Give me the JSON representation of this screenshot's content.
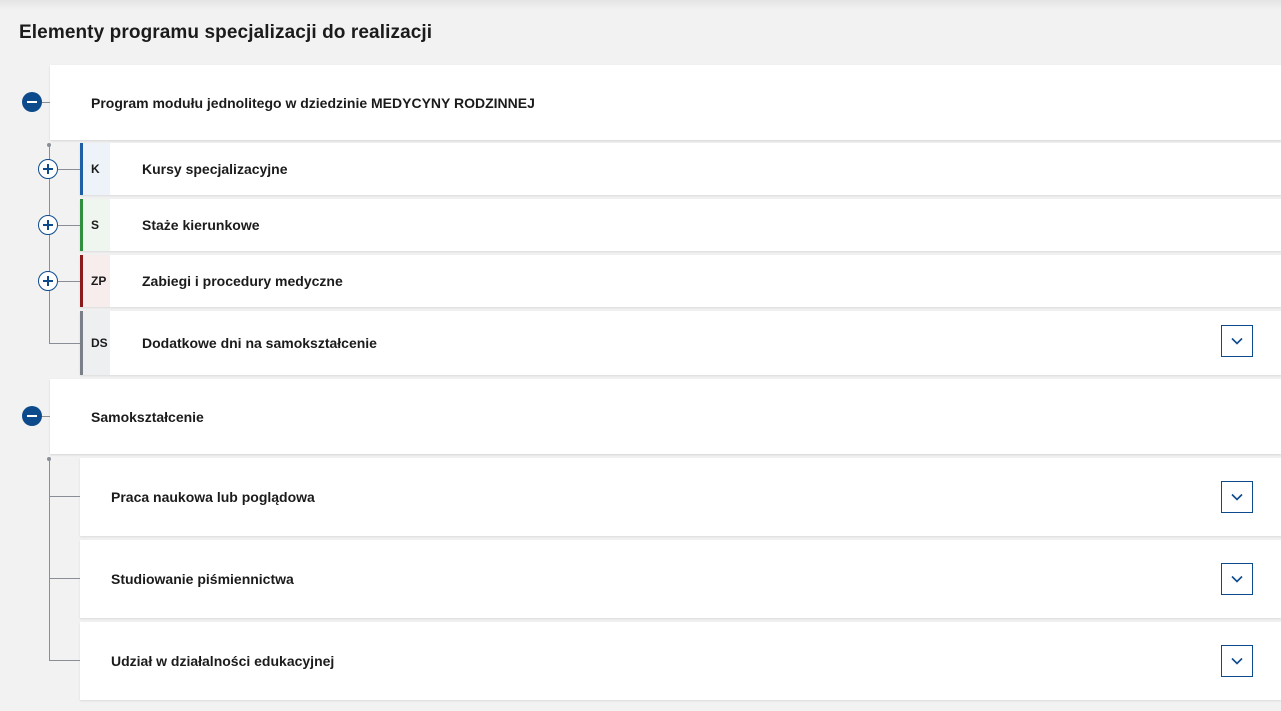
{
  "page": {
    "title": "Elementy programu specjalizacji do realizacji"
  },
  "group1": {
    "title": "Program modułu jednolitego w dziedzinie MEDYCYNY RODZINNEJ",
    "items": [
      {
        "code": "K",
        "label": "Kursy specjalizacyjne",
        "color": "#1f5fa6",
        "bg": "#eef3f9"
      },
      {
        "code": "S",
        "label": "Staże kierunkowe",
        "color": "#2f8f3e",
        "bg": "#eef6ef"
      },
      {
        "code": "ZP",
        "label": "Zabiegi i procedury medyczne",
        "color": "#8b1a1a",
        "bg": "#f7eded"
      },
      {
        "code": "DS",
        "label": "Dodatkowe dni na samokształcenie",
        "color": "#7a7f88",
        "bg": "#eeeff1"
      }
    ]
  },
  "group2": {
    "title": "Samokształcenie",
    "items": [
      {
        "label": "Praca naukowa lub poglądowa"
      },
      {
        "label": "Studiowanie piśmiennictwa"
      },
      {
        "label": "Udział w działalności edukacyjnej"
      }
    ]
  },
  "colors": {
    "accent": "#0d4a8c",
    "connector": "#8a8f97",
    "background": "#f2f2f2"
  },
  "icons": {
    "collapse": "minus-circle-icon",
    "expand": "plus-circle-icon",
    "dropdown": "chevron-down-icon"
  }
}
